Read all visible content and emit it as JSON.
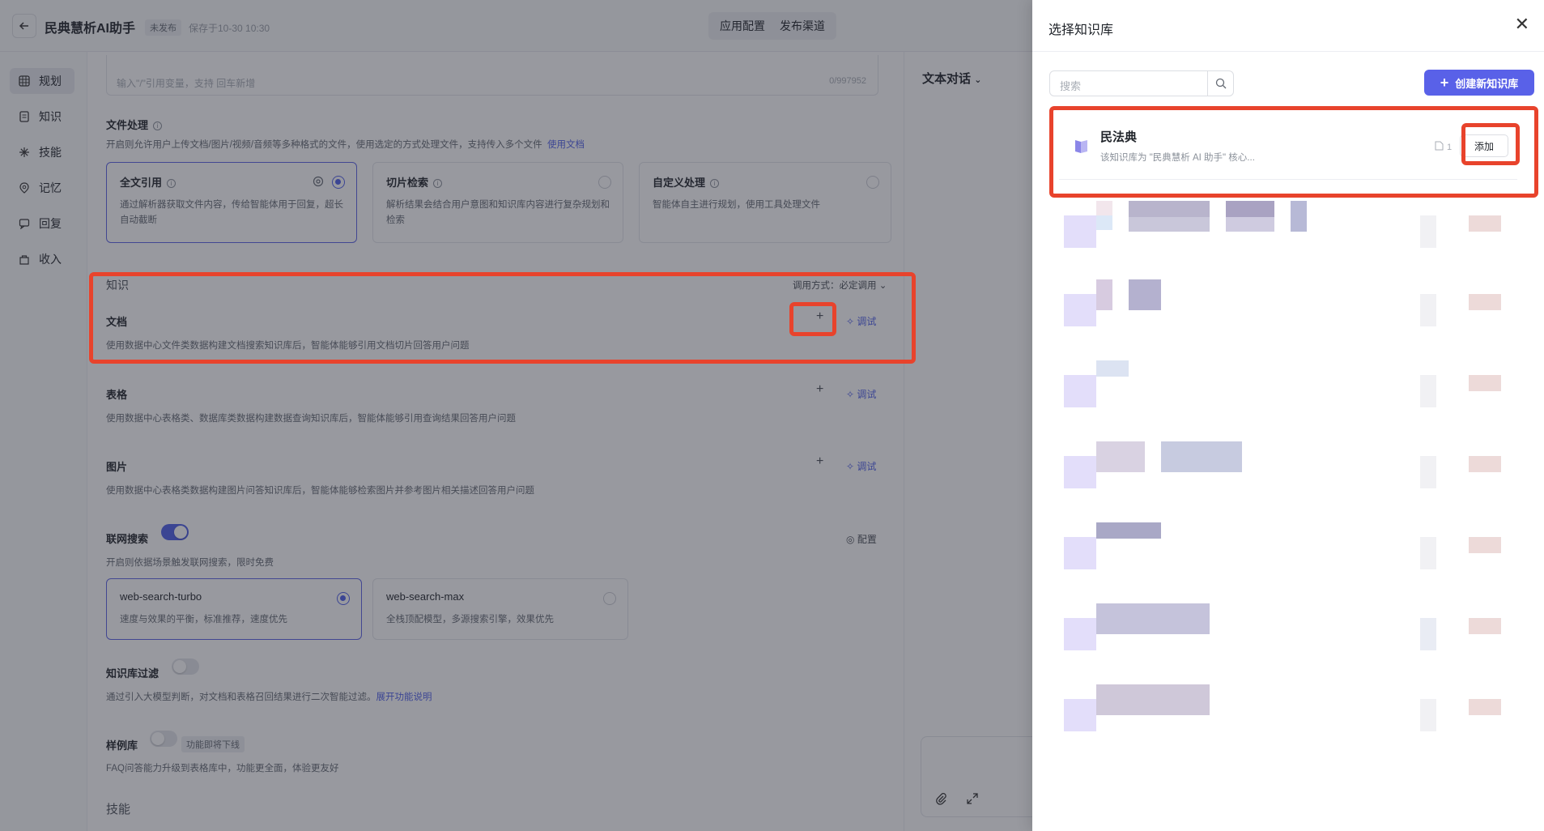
{
  "header": {
    "back_icon": "arrow-left-icon",
    "title": "民典慧析AI助手",
    "status_badge": "未发布",
    "save_time": "保存于10-30 10:30",
    "actions": [
      "应用配置",
      "发布渠道"
    ]
  },
  "nav": {
    "items": [
      {
        "label": "规划",
        "icon": "plan-grid-icon",
        "active": true
      },
      {
        "label": "知识",
        "icon": "document-icon",
        "active": false
      },
      {
        "label": "技能",
        "icon": "skills-icon",
        "active": false
      },
      {
        "label": "记忆",
        "icon": "memory-icon",
        "active": false
      },
      {
        "label": "回复",
        "icon": "reply-icon",
        "active": false
      },
      {
        "label": "收入",
        "icon": "income-icon",
        "active": false
      }
    ]
  },
  "prompt": {
    "placeholder": "输入\"/\"引用变量，支持 回车新增",
    "counter": "0/997952"
  },
  "file_processing": {
    "title": "文件处理",
    "desc": "开启则允许用户上传文档/图片/视频/音频等多种格式的文件，使用选定的方式处理文件，支持传入多个文件",
    "doc_link": "使用文档",
    "options": [
      {
        "title": "全文引用",
        "desc": "通过解析器获取文件内容，传给智能体用于回复，超长自动截断",
        "selected": true
      },
      {
        "title": "切片检索",
        "desc": "解析结果会结合用户意图和知识库内容进行复杂规划和检索",
        "selected": false
      },
      {
        "title": "自定义处理",
        "desc": "智能体自主进行规划，使用工具处理文件",
        "selected": false
      }
    ]
  },
  "knowledge": {
    "title": "知识",
    "call_mode": "调用方式：必定调用",
    "debug_label": "调试",
    "rows": [
      {
        "title": "文档",
        "desc": "使用数据中心文件类数据构建文档搜索知识库后，智能体能够引用文档切片回答用户问题"
      },
      {
        "title": "表格",
        "desc": "使用数据中心表格类、数据库类数据构建数据查询知识库后，智能体能够引用查询结果回答用户问题"
      },
      {
        "title": "图片",
        "desc": "使用数据中心表格类数据构建图片问答知识库后，智能体能够检索图片并参考图片相关描述回答用户问题"
      }
    ]
  },
  "web_search": {
    "title": "联网搜索",
    "enabled": true,
    "config_label": "配置",
    "desc": "开启则依据场景触发联网搜索，限时免费",
    "options": [
      {
        "title": "web-search-turbo",
        "desc": "速度与效果的平衡，标准推荐，速度优先",
        "selected": true
      },
      {
        "title": "web-search-max",
        "desc": "全栈顶配模型，多源搜索引擎，效果优先",
        "selected": false
      }
    ]
  },
  "kb_filter": {
    "title": "知识库过滤",
    "enabled": false,
    "desc": "通过引入大模型判断，对文档和表格召回结果进行二次智能过滤。",
    "link": "展开功能说明"
  },
  "sample_lib": {
    "title": "样例库",
    "enabled": false,
    "tag": "功能即将下线",
    "desc": "FAQ问答能力升级到表格库中，功能更全面，体验更友好"
  },
  "skills": {
    "title": "技能"
  },
  "preview": {
    "title": "文本对话",
    "attach_icon": "paperclip-icon",
    "expand_icon": "expand-icon"
  },
  "drawer": {
    "title": "选择知识库",
    "close_icon": "close-icon",
    "search_placeholder": "搜索",
    "create_label": "创建新知识库",
    "items": [
      {
        "name": "民法典",
        "desc": "该知识库为 \"民典慧析 AI 助手\" 核心...",
        "count": "1",
        "add_label": "添加"
      }
    ]
  },
  "colors": {
    "accent": "#4e5ee8",
    "annotation": "#e8432c",
    "overlay": "rgba(40,42,54,0.48)"
  }
}
